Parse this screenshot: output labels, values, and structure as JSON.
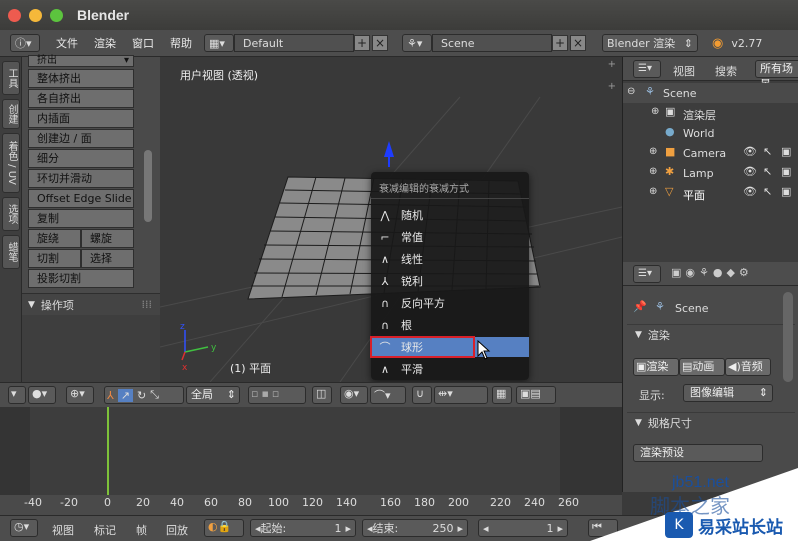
{
  "window": {
    "title": "Blender"
  },
  "menubar": {
    "items": [
      "文件",
      "渲染",
      "窗口",
      "帮助"
    ],
    "layout": "Default",
    "scene": "Scene",
    "engine": "Blender 渲染",
    "version": "v2.77"
  },
  "toolshelf": {
    "tabs": [
      "工具",
      "创建",
      "着色 / UV",
      "选项",
      "蜡笔"
    ],
    "header": "挤出",
    "buttons": [
      "整体挤出",
      "各自挤出",
      "内插面",
      "创建边 / 面",
      "细分",
      "环切并滑动",
      "Offset Edge Slide",
      "复制"
    ],
    "pair1": [
      "旋绕",
      "螺旋"
    ],
    "pair2": [
      "切割",
      "选择"
    ],
    "last": "投影切割",
    "operator_panel": "操作项"
  },
  "viewport": {
    "view_name": "用户视图 (透视)",
    "object_label": "(1) 平面"
  },
  "falloff_menu": {
    "title": "衰减编辑的衰减方式",
    "items": [
      {
        "label": "随机",
        "icon": "random-falloff-icon"
      },
      {
        "label": "常值",
        "icon": "constant-falloff-icon"
      },
      {
        "label": "线性",
        "icon": "linear-falloff-icon"
      },
      {
        "label": "锐利",
        "icon": "sharp-falloff-icon"
      },
      {
        "label": "反向平方",
        "icon": "inverse-square-falloff-icon"
      },
      {
        "label": "根",
        "icon": "root-falloff-icon"
      },
      {
        "label": "球形",
        "icon": "sphere-falloff-icon",
        "highlighted": true
      },
      {
        "label": "平滑",
        "icon": "smooth-falloff-icon"
      }
    ]
  },
  "view3d_header": {
    "orientation": "全局"
  },
  "outliner": {
    "tabs": [
      "视图",
      "搜索",
      "所有场景"
    ],
    "items": [
      "Scene",
      "渲染层",
      "World",
      "Camera",
      "Lamp",
      "平面"
    ]
  },
  "properties": {
    "scene": "Scene",
    "render_panel": "渲染",
    "buttons": [
      "渲染",
      "动画",
      "音频"
    ],
    "display_label": "显示:",
    "display_value": "图像编辑",
    "dimensions_panel": "规格尺寸",
    "preset": "渲染预设"
  },
  "timeline": {
    "ticks": [
      "-40",
      "-20",
      "0",
      "20",
      "40",
      "60",
      "80",
      "100",
      "120",
      "140",
      "160",
      "180",
      "200",
      "220",
      "240",
      "260"
    ],
    "menu": [
      "视图",
      "标记",
      "帧",
      "回放"
    ],
    "start_label": "起始:",
    "start_value": "1",
    "end_label": "结束:",
    "end_value": "250",
    "current": "1"
  },
  "watermark": {
    "site": "jb51.net",
    "text": "脚本之家",
    "brand": "易采站长站"
  },
  "colors": {
    "highlight": "#5680c2",
    "red_box": "#d8202a",
    "blue_axis": "#1e3cff",
    "green_frame": "#7ec23a"
  }
}
